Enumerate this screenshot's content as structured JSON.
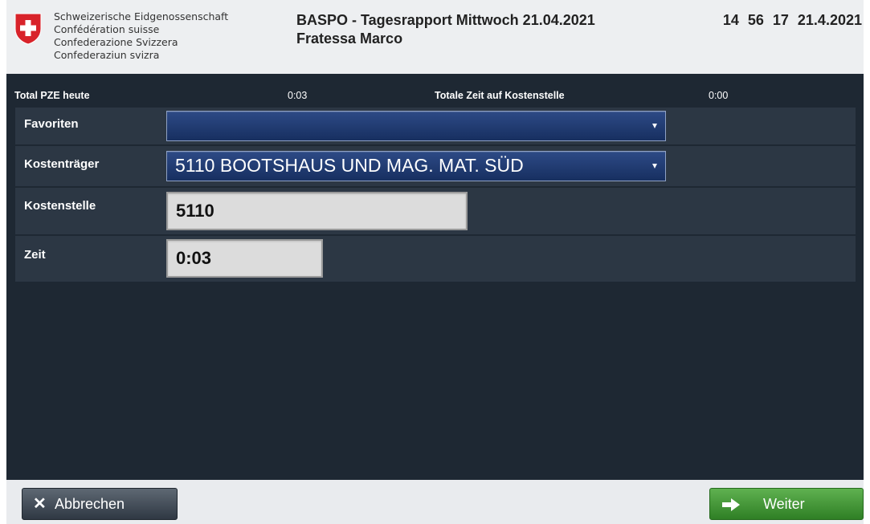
{
  "header": {
    "confederation_lines": [
      "Schweizerische Eidgenossenschaft",
      "Confédération suisse",
      "Confederazione Svizzera",
      "Confederaziun svizra"
    ],
    "title": "BASPO - Tagesrapport Mittwoch 21.04.2021",
    "subtitle": "Fratessa Marco",
    "clock": "14 56 17  21.4.2021"
  },
  "summary": {
    "total_pze_label": "Total PZE heute",
    "total_pze_value": "0:03",
    "cost_center_time_label": "Totale Zeit auf Kostenstelle",
    "cost_center_time_value": "0:00"
  },
  "form": {
    "favoriten": {
      "label": "Favoriten",
      "value": ""
    },
    "kostentraeger": {
      "label": "Kostenträger",
      "value": "5110 BOOTSHAUS UND MAG. MAT. SÜD"
    },
    "kostenstelle": {
      "label": "Kostenstelle",
      "value": "5110"
    },
    "zeit": {
      "label": "Zeit",
      "value": "0:03"
    }
  },
  "footer": {
    "cancel_label": "Abbrechen",
    "cancel_icon": "✕",
    "next_label": "Weiter"
  },
  "colors": {
    "panel_bg": "#1e2833",
    "row_bg": "#2c3744",
    "select_bg": "#1f3a72",
    "next_green": "#3f9a34",
    "swiss_red": "#d8232a"
  }
}
